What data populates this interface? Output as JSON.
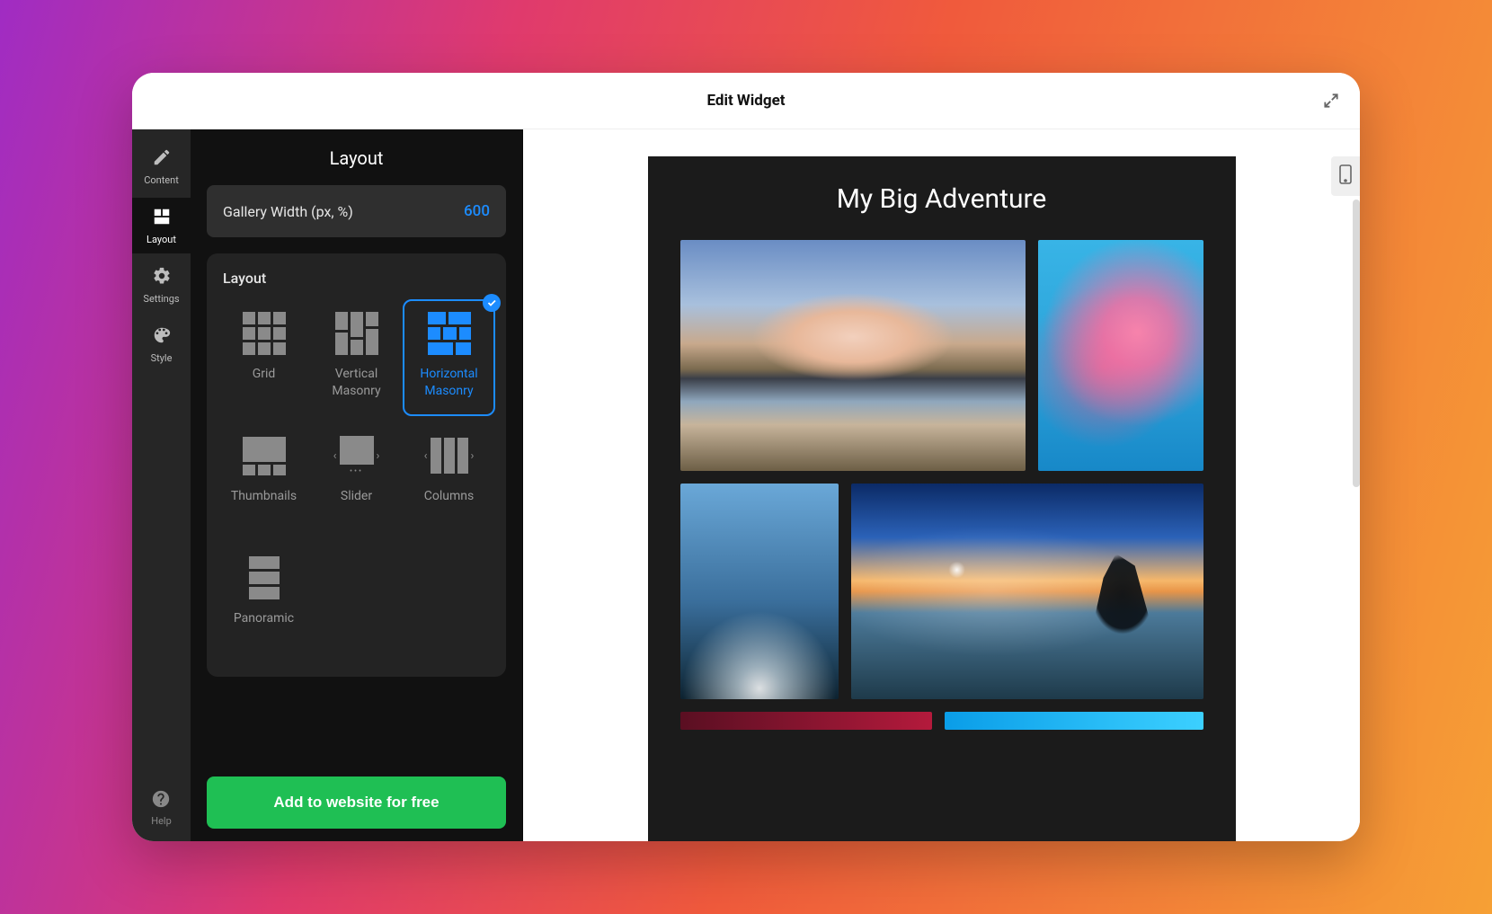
{
  "titlebar": {
    "title": "Edit Widget"
  },
  "rail": {
    "items": [
      {
        "label": "Content",
        "icon": "pencil-icon"
      },
      {
        "label": "Layout",
        "icon": "layout-icon",
        "active": true
      },
      {
        "label": "Settings",
        "icon": "gear-icon"
      },
      {
        "label": "Style",
        "icon": "palette-icon"
      }
    ],
    "help_label": "Help"
  },
  "panel": {
    "title": "Layout",
    "gallery_width": {
      "label": "Gallery Width (px, %)",
      "value": "600"
    },
    "layout_section_title": "Layout",
    "options": [
      {
        "id": "grid",
        "label": "Grid"
      },
      {
        "id": "vmasonry",
        "label": "Vertical Masonry"
      },
      {
        "id": "hmasonry",
        "label": "Horizontal Masonry",
        "selected": true
      },
      {
        "id": "thumbnails",
        "label": "Thumbnails"
      },
      {
        "id": "slider",
        "label": "Slider"
      },
      {
        "id": "columns",
        "label": "Columns"
      },
      {
        "id": "panoramic",
        "label": "Panoramic"
      }
    ],
    "cta_label": "Add to website for free"
  },
  "preview": {
    "heading": "My Big Adventure",
    "device": "mobile"
  }
}
